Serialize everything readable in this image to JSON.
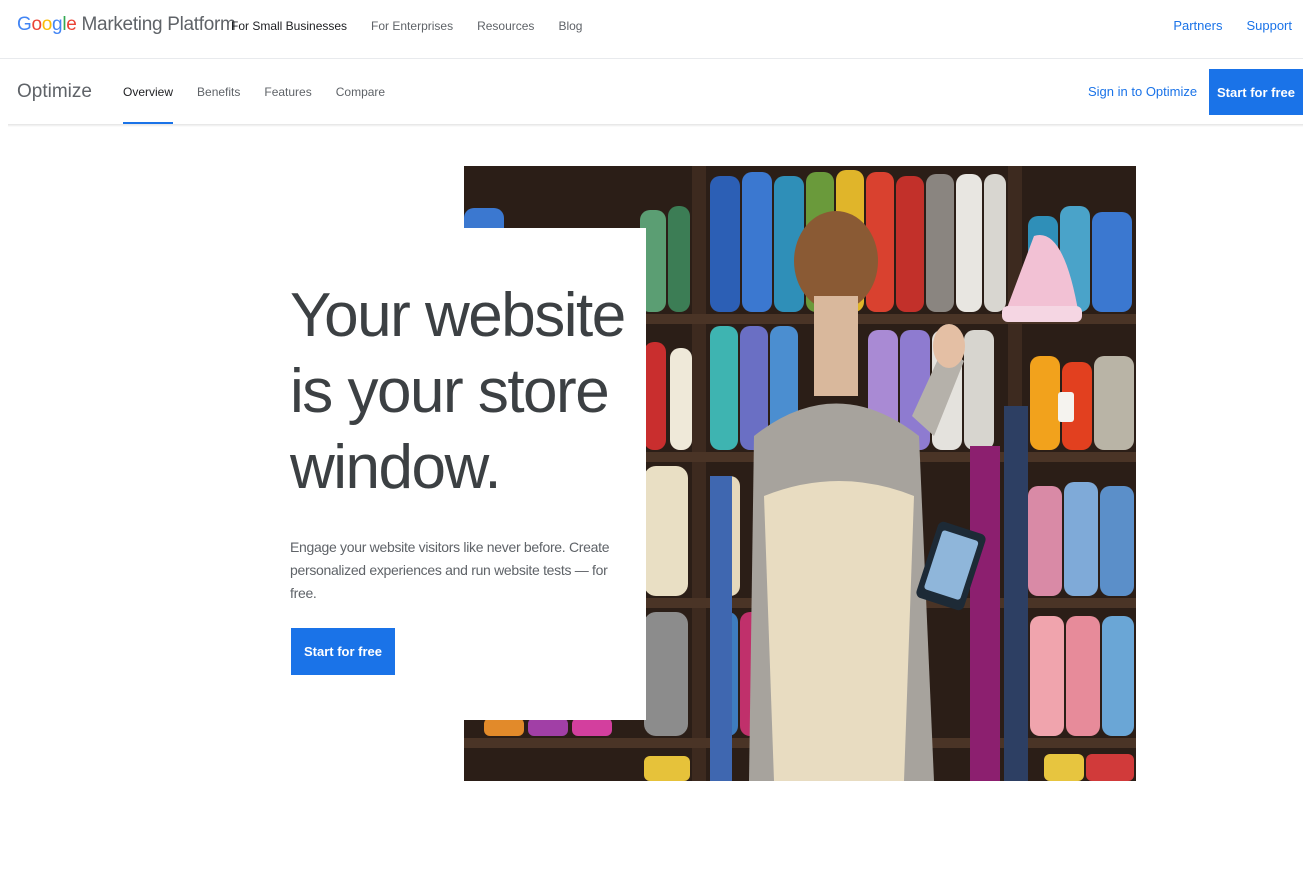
{
  "header": {
    "brand_google_letters": [
      "G",
      "o",
      "o",
      "g",
      "l",
      "e"
    ],
    "brand_google_colors": [
      "#4285f4",
      "#ea4335",
      "#fbbc05",
      "#4285f4",
      "#34a853",
      "#ea4335"
    ],
    "brand_product": "Marketing Platform",
    "nav": [
      "For Small Businesses",
      "For Enterprises",
      "Resources",
      "Blog"
    ],
    "right_links": [
      "Partners",
      "Support"
    ]
  },
  "product_bar": {
    "product_name": "Optimize",
    "tabs": [
      "Overview",
      "Benefits",
      "Features",
      "Compare"
    ],
    "active_tab": "Overview",
    "sign_in_label": "Sign in to Optimize",
    "start_label": "Start for free"
  },
  "hero": {
    "headline": "Your website is your store window.",
    "subtext": "Engage your website visitors like never before. Create personalized experiences and run website tests — for free.",
    "cta_label": "Start for free"
  },
  "colors": {
    "accent": "#1a73e8",
    "text_dark": "#3c4043",
    "text_muted": "#5f6368"
  }
}
